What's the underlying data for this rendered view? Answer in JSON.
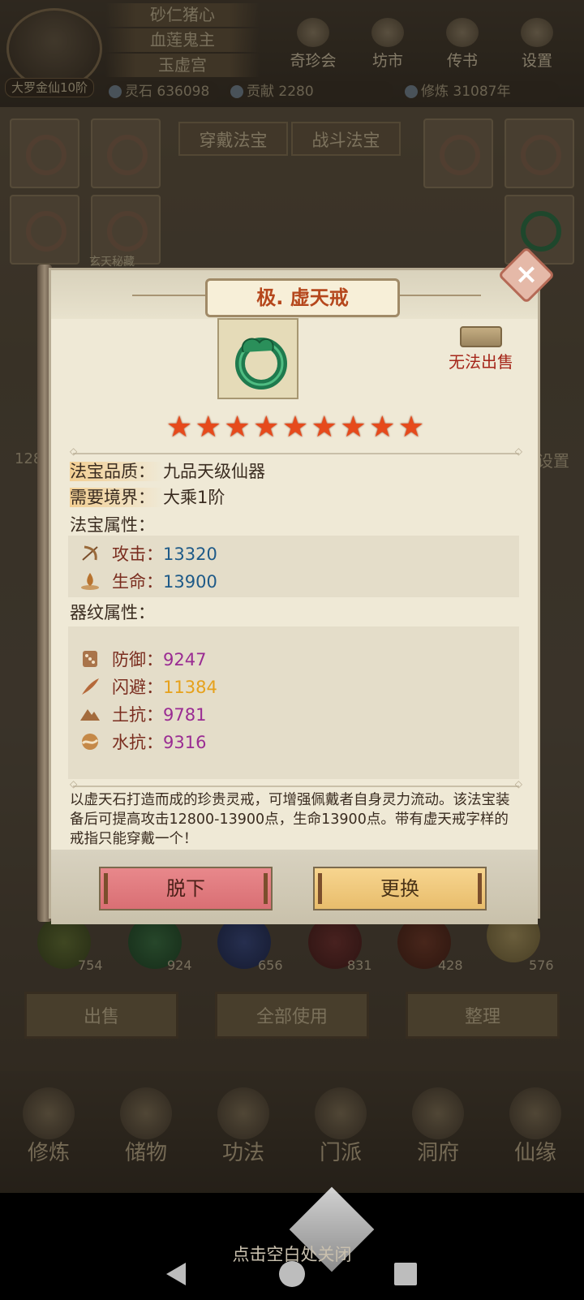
{
  "header": {
    "rank": "大罗金仙10阶",
    "titles": [
      "砂仁猪心",
      "血莲鬼主",
      "玉虚宫"
    ],
    "nav": [
      "奇珍会",
      "坊市",
      "传书",
      "设置"
    ],
    "resources": {
      "spirit_stone": "灵石 636098",
      "contribution": "贡献 2280",
      "cultivation": "修炼 31087年"
    }
  },
  "background": {
    "tabs": [
      "穿戴法宝",
      "战斗法宝"
    ],
    "slot_label": "玄天秘藏",
    "left_number": "128",
    "right_label": "设置",
    "counts": [
      "754",
      "924",
      "656",
      "831",
      "428",
      "576"
    ],
    "actions": [
      "出售",
      "全部使用",
      "整理"
    ],
    "main_nav": [
      "修炼",
      "储物",
      "功法",
      "门派",
      "洞府",
      "仙缘"
    ]
  },
  "item": {
    "title": "极. 虚天戒",
    "no_sell": "无法出售",
    "stars": 9,
    "quality_label": "法宝品质：",
    "quality_value": "九品天级仙器",
    "realm_label": "需要境界：",
    "realm_value": "大乘1阶",
    "attr_header": "法宝属性：",
    "attrs": [
      {
        "label": "攻击：",
        "value": "13320",
        "icon": "bow-icon"
      },
      {
        "label": "生命：",
        "value": "13900",
        "icon": "flame-icon"
      }
    ],
    "pattern_header": "器纹属性：",
    "patterns": [
      {
        "label": "防御：",
        "value": "9247",
        "icon": "dice-icon",
        "color": "#9a2c93"
      },
      {
        "label": "闪避：",
        "value": "11384",
        "icon": "feather-icon",
        "color": "#e6a11b"
      },
      {
        "label": "土抗：",
        "value": "9781",
        "icon": "mountain-icon",
        "color": "#9a2c93"
      },
      {
        "label": "水抗：",
        "value": "9316",
        "icon": "wave-icon",
        "color": "#9a2c93"
      }
    ],
    "description": "以虚天石打造而成的珍贵灵戒，可增强佩戴者自身灵力流动。该法宝装备后可提高攻击12800-13900点，生命13900点。带有虚天戒字样的戒指只能穿戴一个！",
    "buttons": {
      "remove": "脱下",
      "replace": "更换"
    }
  },
  "footer": {
    "close_hint": "点击空白处关闭"
  }
}
